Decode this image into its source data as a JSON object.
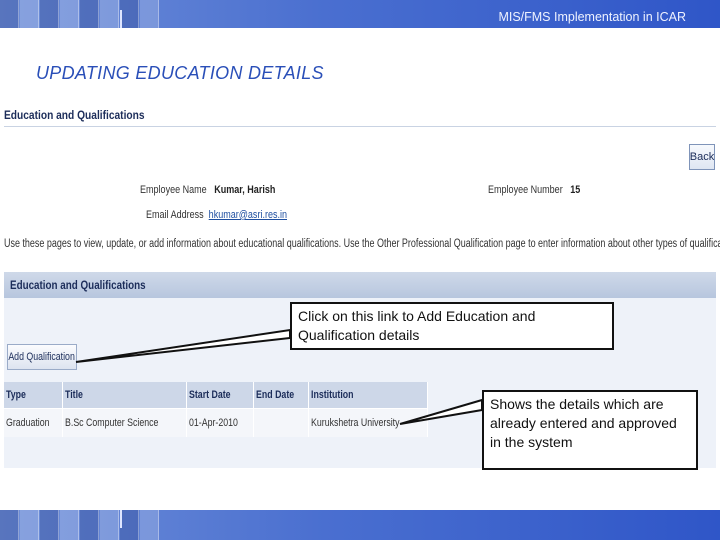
{
  "banner": {
    "title": "MIS/FMS Implementation in ICAR"
  },
  "slide": {
    "title": "UPDATING EDUCATION DETAILS"
  },
  "screen": {
    "page_heading": "Education and Qualifications",
    "back_button": "Back",
    "employee_name_label": "Employee Name",
    "employee_name_value": "Kumar, Harish",
    "employee_number_label": "Employee Number",
    "employee_number_value": "15",
    "email_label": "Email Address",
    "email_value": "hkumar@asri.res.in",
    "instructions": "Use these pages to view, update, or add information about educational qualifications. Use the Other Professional Qualification page to enter information about other types of qualification.",
    "section_title": "Education and Qualifications",
    "add_button": "Add Qualification",
    "table": {
      "columns": [
        "Type",
        "Title",
        "Start Date",
        "End Date",
        "Institution"
      ],
      "rows": [
        [
          "Graduation",
          "B.Sc Computer Science",
          "01-Apr-2010",
          "",
          "Kurukshetra University"
        ]
      ]
    }
  },
  "callouts": {
    "add_link": "Click on this link to Add Education  and Qualification details",
    "details": "Shows the details which are already entered and approved in the system"
  },
  "colors": {
    "banner": "#3a5fcb",
    "title": "#2a4fb8",
    "section_header": "#c3d0e4"
  }
}
